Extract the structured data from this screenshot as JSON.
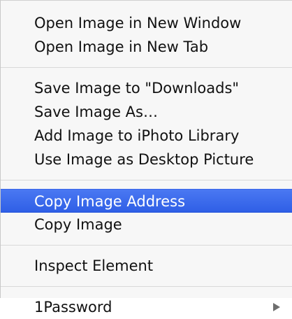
{
  "menu": {
    "groups": [
      {
        "items": [
          {
            "label": "Open Image in New Window"
          },
          {
            "label": "Open Image in New Tab"
          }
        ]
      },
      {
        "items": [
          {
            "label": "Save Image to \"Downloads\""
          },
          {
            "label": "Save Image As…"
          },
          {
            "label": "Add Image to iPhoto Library"
          },
          {
            "label": "Use Image as Desktop Picture"
          }
        ]
      },
      {
        "items": [
          {
            "label": "Copy Image Address"
          },
          {
            "label": "Copy Image"
          }
        ]
      },
      {
        "items": [
          {
            "label": "Inspect Element"
          }
        ]
      },
      {
        "items": [
          {
            "label": "1Password",
            "submenu_icon": "chevron-right-icon"
          }
        ]
      }
    ],
    "highlighted_item": "Copy Image Address",
    "colors": {
      "background": "#f7f7f7",
      "highlight": "#3465ea",
      "text": "#111111",
      "separator": "#d9d9d9"
    }
  }
}
